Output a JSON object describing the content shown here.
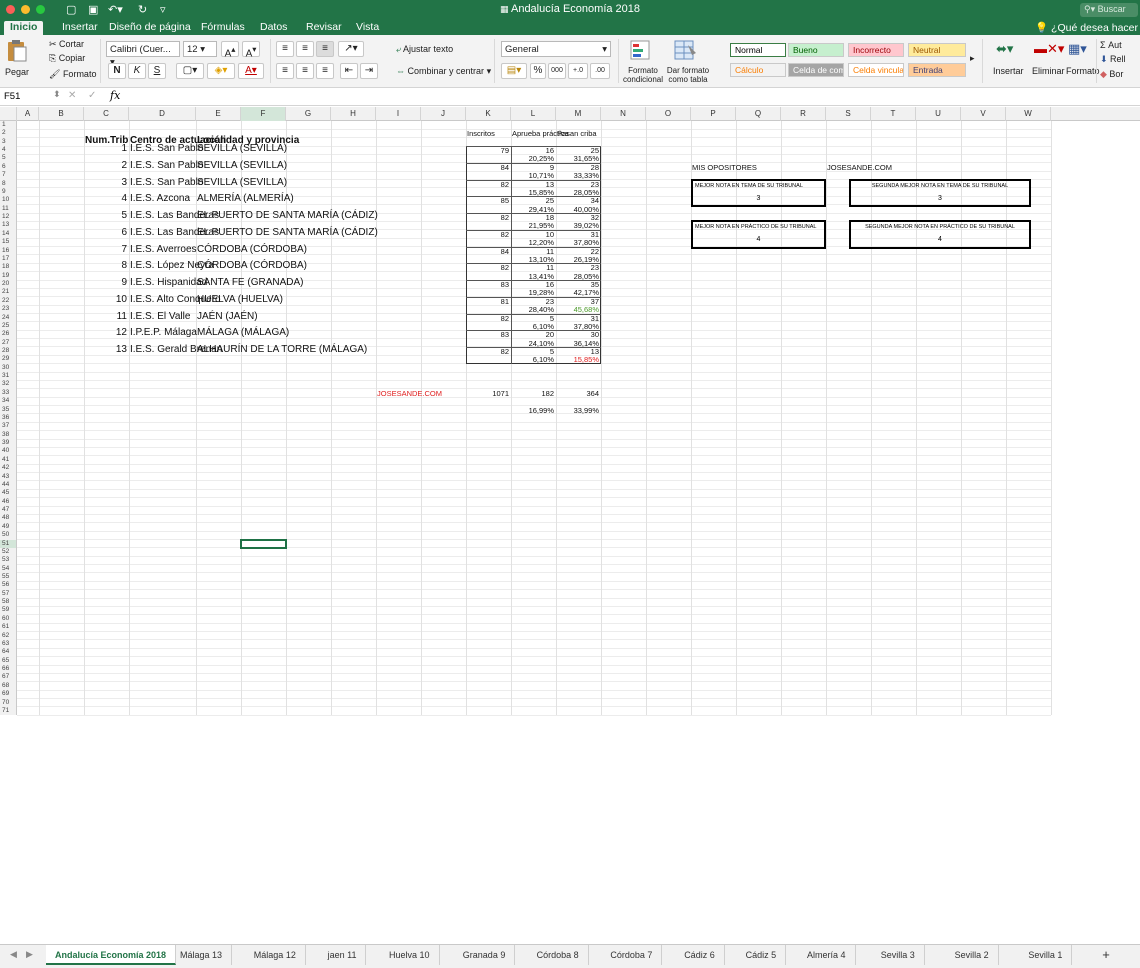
{
  "window": {
    "title": "Andalucía Economía 2018",
    "search_placeholder": "Buscar"
  },
  "ribbon_tabs": [
    "Inicio",
    "Insertar",
    "Diseño de página",
    "Fórmulas",
    "Datos",
    "Revisar",
    "Vista"
  ],
  "tell_me": "¿Qué desea hacer",
  "ribbon": {
    "paste": "Pegar",
    "cut": "Cortar",
    "copy": "Copiar",
    "format_painter": "Formato",
    "font_name": "Calibri (Cuer...",
    "font_size": "12",
    "bold": "N",
    "italic": "K",
    "underline": "S",
    "wrap_text": "Ajustar texto",
    "merge_center": "Combinar y centrar",
    "number_format": "General",
    "cond_format": "Formato condicional",
    "format_table": "Dar formato como tabla",
    "styles": [
      {
        "label": "Normal",
        "bg": "#ffffff",
        "fg": "#000000"
      },
      {
        "label": "Bueno",
        "bg": "#c6efce",
        "fg": "#006100"
      },
      {
        "label": "Incorrecto",
        "bg": "#ffc7ce",
        "fg": "#9c0006"
      },
      {
        "label": "Neutral",
        "bg": "#ffeb9c",
        "fg": "#9c5700"
      },
      {
        "label": "Cálculo",
        "bg": "#f2f2f2",
        "fg": "#fa7d00"
      },
      {
        "label": "Celda de com...",
        "bg": "#a5a5a5",
        "fg": "#ffffff"
      },
      {
        "label": "Celda vinculada",
        "bg": "#ffffff",
        "fg": "#fa7d00"
      },
      {
        "label": "Entrada",
        "bg": "#ffcc99",
        "fg": "#3f3f76"
      }
    ],
    "insert": "Insertar",
    "delete": "Eliminar",
    "format": "Formato",
    "autosum": "Aut",
    "fill": "Rell",
    "clear": "Bor"
  },
  "formula_bar": {
    "cell_ref": "F51",
    "fx": "fx",
    "content": ""
  },
  "columns": [
    "A",
    "B",
    "C",
    "D",
    "E",
    "F",
    "G",
    "H",
    "I",
    "J",
    "K",
    "L",
    "M",
    "N",
    "O",
    "P",
    "Q",
    "R",
    "S",
    "T",
    "U",
    "V",
    "W"
  ],
  "headers": {
    "num_trib": "Num.Trib",
    "centro": "Centro de actuación",
    "localidad": "Localidad y provincia",
    "inscritos": "Inscritos",
    "aprueba": "Aprueba práctica",
    "pasan": "Pasan criba"
  },
  "tribunales": [
    {
      "num": "1",
      "centro": "I.E.S. San Pablo",
      "localidad": "SEVILLA (SEVILLA)",
      "inscritos": "79",
      "aprueba": "16",
      "pasan": "25",
      "pct_aprueba": "20,25%",
      "pct_pasan": "31,65%",
      "pct_pasan_color": ""
    },
    {
      "num": "2",
      "centro": "I.E.S. San Pablo",
      "localidad": "SEVILLA (SEVILLA)",
      "inscritos": "84",
      "aprueba": "9",
      "pasan": "28",
      "pct_aprueba": "10,71%",
      "pct_pasan": "33,33%",
      "pct_pasan_color": ""
    },
    {
      "num": "3",
      "centro": "I.E.S. San Pablo",
      "localidad": "SEVILLA (SEVILLA)",
      "inscritos": "82",
      "aprueba": "13",
      "pasan": "23",
      "pct_aprueba": "15,85%",
      "pct_pasan": "28,05%",
      "pct_pasan_color": ""
    },
    {
      "num": "4",
      "centro": "I.E.S. Azcona",
      "localidad": "ALMERÍA (ALMERÍA)",
      "inscritos": "85",
      "aprueba": "25",
      "pasan": "34",
      "pct_aprueba": "29,41%",
      "pct_pasan": "40,00%",
      "pct_pasan_color": ""
    },
    {
      "num": "5",
      "centro": "I.E.S. Las Banderas",
      "localidad": "EL PUERTO DE SANTA MARÍA (CÁDIZ)",
      "inscritos": "82",
      "aprueba": "18",
      "pasan": "32",
      "pct_aprueba": "21,95%",
      "pct_pasan": "39,02%",
      "pct_pasan_color": ""
    },
    {
      "num": "6",
      "centro": "I.E.S. Las Banderas",
      "localidad": "EL PUERTO DE SANTA MARÍA (CÁDIZ)",
      "inscritos": "82",
      "aprueba": "10",
      "pasan": "31",
      "pct_aprueba": "12,20%",
      "pct_pasan": "37,80%",
      "pct_pasan_color": ""
    },
    {
      "num": "7",
      "centro": "I.E.S. Averroes",
      "localidad": "CÓRDOBA (CÓRDOBA)",
      "inscritos": "84",
      "aprueba": "11",
      "pasan": "22",
      "pct_aprueba": "13,10%",
      "pct_pasan": "26,19%",
      "pct_pasan_color": ""
    },
    {
      "num": "8",
      "centro": "I.E.S. López Neyra",
      "localidad": "CÓRDOBA (CÓRDOBA)",
      "inscritos": "82",
      "aprueba": "11",
      "pasan": "23",
      "pct_aprueba": "13,41%",
      "pct_pasan": "28,05%",
      "pct_pasan_color": ""
    },
    {
      "num": "9",
      "centro": "I.E.S. Hispanidad",
      "localidad": "SANTA FE (GRANADA)",
      "inscritos": "83",
      "aprueba": "16",
      "pasan": "35",
      "pct_aprueba": "19,28%",
      "pct_pasan": "42,17%",
      "pct_pasan_color": ""
    },
    {
      "num": "10",
      "centro": "I.E.S. Alto Conquero",
      "localidad": "HUELVA (HUELVA)",
      "inscritos": "81",
      "aprueba": "23",
      "pasan": "37",
      "pct_aprueba": "28,40%",
      "pct_pasan": "45,68%",
      "pct_pasan_color": "#4c9a2a"
    },
    {
      "num": "11",
      "centro": "I.E.S. El Valle",
      "localidad": "JAÉN (JAÉN)",
      "inscritos": "82",
      "aprueba": "5",
      "pasan": "31",
      "pct_aprueba": "6,10%",
      "pct_pasan": "37,80%",
      "pct_pasan_color": ""
    },
    {
      "num": "12",
      "centro": "I.P.E.P. Málaga",
      "localidad": "MÁLAGA (MÁLAGA)",
      "inscritos": "83",
      "aprueba": "20",
      "pasan": "30",
      "pct_aprueba": "24,10%",
      "pct_pasan": "36,14%",
      "pct_pasan_color": ""
    },
    {
      "num": "13",
      "centro": "I.E.S. Gerald Brenan",
      "localidad": "ALHAURÍN DE LA TORRE (MÁLAGA)",
      "inscritos": "82",
      "aprueba": "5",
      "pasan": "13",
      "pct_aprueba": "6,10%",
      "pct_pasan": "15,85%",
      "pct_pasan_color": "#e02020"
    }
  ],
  "totals": {
    "site_label": "JOSESANDE.COM",
    "site_color": "#e02020",
    "inscritos": "1071",
    "aprueba": "182",
    "pasan": "364",
    "pct_aprueba": "16,99%",
    "pct_pasan": "33,99%"
  },
  "side_panel": {
    "mis_opositores": "MIS OPOSITORES",
    "site": "JOSESANDE.COM",
    "boxes": [
      {
        "label": "MEJOR NOTA EN TEMA DE SU TRIBUNAL",
        "value": "3"
      },
      {
        "label": "SEGUNDA MEJOR NOTA EN TEMA DE SU TRIBUNAL",
        "value": "3"
      },
      {
        "label": "MEJOR NOTA EN PRÁCTICO DE SU TRIBUNAL",
        "value": "4"
      },
      {
        "label": "SEGUNDA MEJOR NOTA EN PRÁCTICO DE SU TRIBUNAL",
        "value": "4"
      }
    ]
  },
  "sheet_tabs": [
    "Andalucía Economía 2018",
    "Málaga 13",
    "Málaga 12",
    "jaen 11",
    "Huelva 10",
    "Granada 9",
    "Córdoba 8",
    "Córdoba 7",
    "Cádiz 6",
    "Cádiz 5",
    "Almería 4",
    "Sevilla 3",
    "Sevilla 2",
    "Sevilla 1"
  ],
  "add_sheet": "+",
  "colors": {
    "accent": "#227447",
    "selection": "#1e7145"
  }
}
